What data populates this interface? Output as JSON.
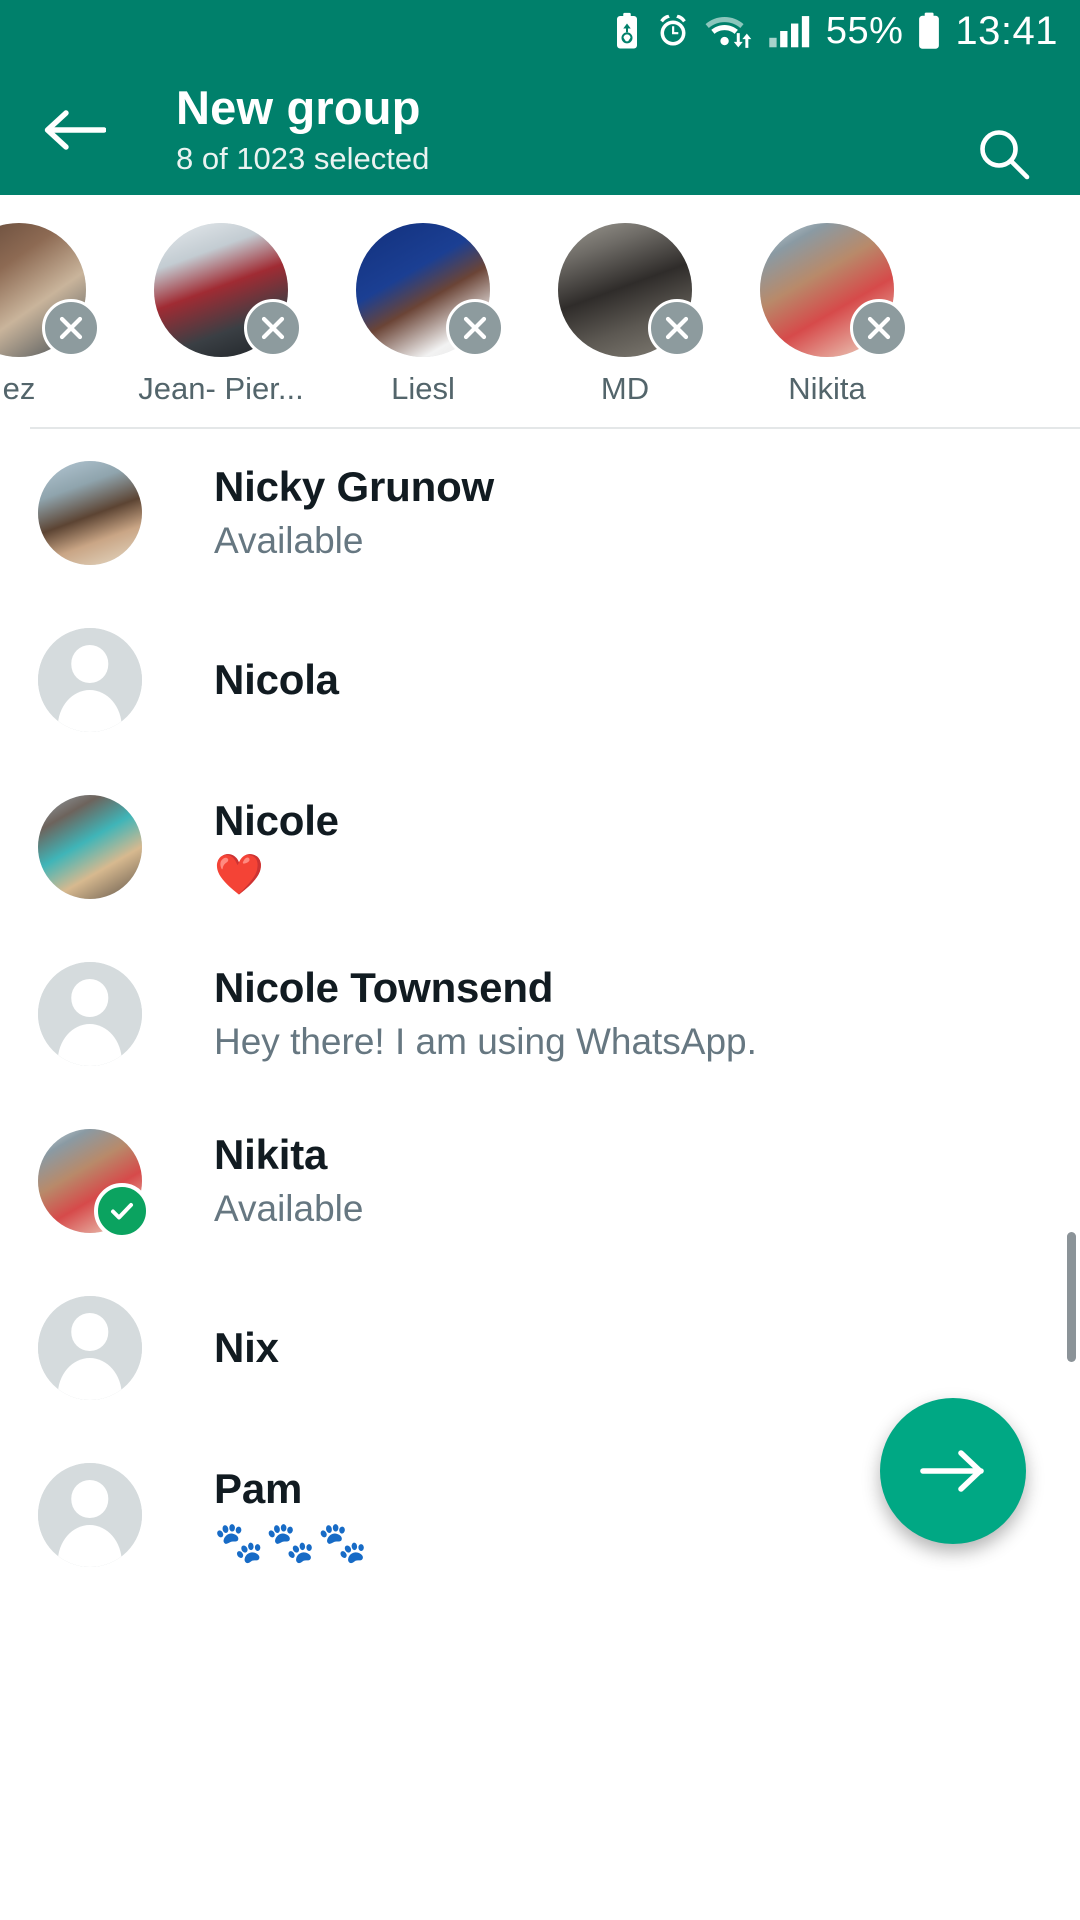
{
  "status_bar": {
    "battery_percent": "55%",
    "time": "13:41",
    "icons": [
      "battery-saver-icon",
      "alarm-icon",
      "wifi-icon",
      "signal-icon",
      "battery-icon"
    ]
  },
  "app_bar": {
    "back_label": "back-arrow",
    "title": "New group",
    "subtitle": "8 of 1023 selected",
    "search_label": "search"
  },
  "theme": {
    "header_green": "#00806b",
    "fab_green": "#00a884",
    "check_green": "#0ba360",
    "name_color": "#111b21",
    "status_color": "#667781",
    "chip_x_grey": "#8d9b9e"
  },
  "selected_chips": [
    {
      "name": "ez",
      "avatar": "photo",
      "photo_class": "ph-chip-left",
      "remove": "×"
    },
    {
      "name": "Jean- Pier...",
      "avatar": "photo",
      "photo_class": "ph-chip-jean",
      "remove": "×"
    },
    {
      "name": "Liesl",
      "avatar": "photo",
      "photo_class": "ph-chip-liesl",
      "remove": "×"
    },
    {
      "name": "MD",
      "avatar": "photo",
      "photo_class": "ph-chip-md",
      "remove": "×"
    },
    {
      "name": "Nikita",
      "avatar": "photo",
      "photo_class": "ph-chip-nikita",
      "remove": "×"
    }
  ],
  "contacts": [
    {
      "name": "Nicky Grunow",
      "status": "Available",
      "avatar": "photo",
      "photo_class": "ph-nicky",
      "selected": false
    },
    {
      "name": "Nicola",
      "status": "",
      "avatar": "placeholder",
      "photo_class": "",
      "selected": false
    },
    {
      "name": "Nicole",
      "status": "❤️",
      "avatar": "photo",
      "photo_class": "ph-nicole",
      "selected": false
    },
    {
      "name": "Nicole Townsend",
      "status": "Hey there! I am using WhatsApp.",
      "avatar": "placeholder",
      "photo_class": "",
      "selected": false
    },
    {
      "name": "Nikita",
      "status": "Available",
      "avatar": "photo",
      "photo_class": "ph-nikita",
      "selected": true
    },
    {
      "name": "Nix",
      "status": "",
      "avatar": "placeholder",
      "photo_class": "",
      "selected": false
    },
    {
      "name": "Pam",
      "status": "🐾🐾🐾",
      "avatar": "placeholder",
      "photo_class": "",
      "selected": false
    }
  ],
  "fab": {
    "label": "next",
    "icon": "arrow-right-icon"
  }
}
